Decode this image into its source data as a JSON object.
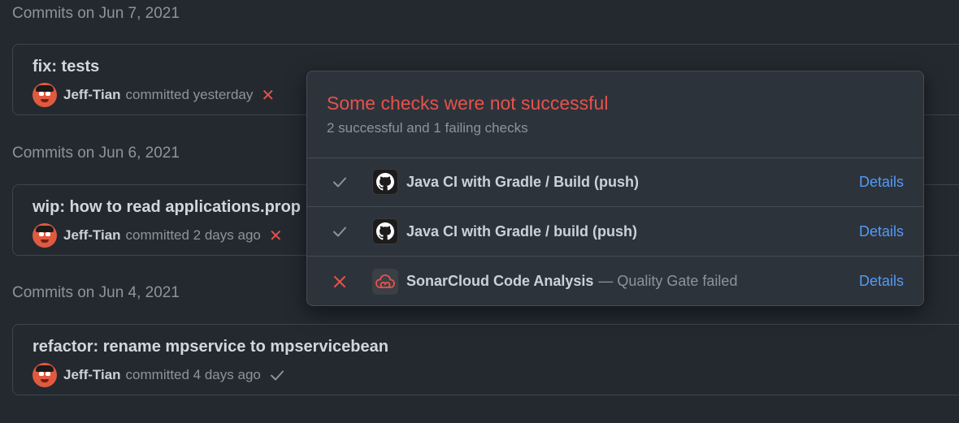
{
  "groups": [
    {
      "date_label": "Commits on Jun 7, 2021",
      "commit": {
        "message": "fix: tests",
        "author": "Jeff-Tian",
        "time": "committed yesterday",
        "status": "failure"
      }
    },
    {
      "date_label": "Commits on Jun 6, 2021",
      "commit": {
        "message": "wip: how to read applications.prop",
        "author": "Jeff-Tian",
        "time": "committed 2 days ago",
        "status": "failure"
      }
    },
    {
      "date_label": "Commits on Jun 4, 2021",
      "commit": {
        "message": "refactor: rename mpservice to mpservicebean",
        "author": "Jeff-Tian",
        "time": "committed 4 days ago",
        "status": "success"
      }
    }
  ],
  "popover": {
    "title": "Some checks were not successful",
    "subtitle": "2 successful and 1 failing checks",
    "checks": [
      {
        "name": "Java CI with Gradle / Build (push)",
        "description": "",
        "status": "success",
        "app_icon": "github-icon",
        "details_label": "Details"
      },
      {
        "name": "Java CI with Gradle / build (push)",
        "description": "",
        "status": "success",
        "app_icon": "github-icon",
        "details_label": "Details"
      },
      {
        "name": "SonarCloud Code Analysis",
        "description": "— Quality Gate failed",
        "status": "failure",
        "app_icon": "sonarcloud-icon",
        "details_label": "Details"
      }
    ]
  },
  "colors": {
    "failure": "#e5534b",
    "success": "#8b949e",
    "link": "#539bf5",
    "background": "#24292f"
  }
}
